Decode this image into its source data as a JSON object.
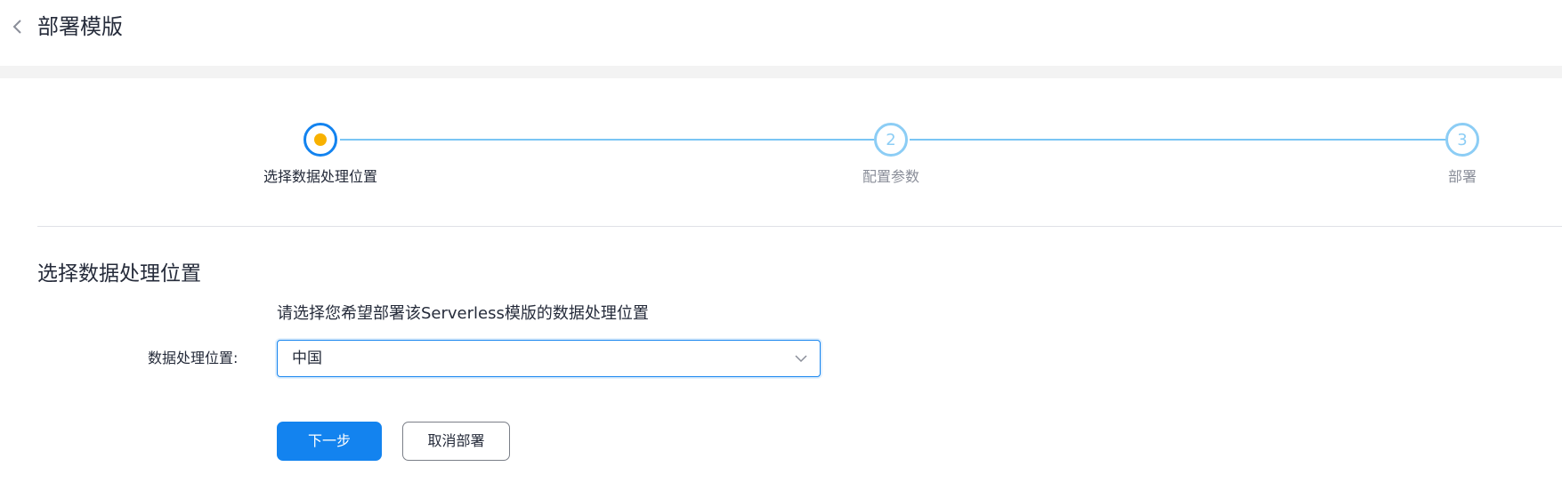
{
  "header": {
    "title": "部署模版"
  },
  "steps": [
    {
      "label": "选择数据处理位置",
      "number": "1",
      "state": "active"
    },
    {
      "label": "配置参数",
      "number": "2",
      "state": "pending"
    },
    {
      "label": "部署",
      "number": "3",
      "state": "pending"
    }
  ],
  "section": {
    "title": "选择数据处理位置",
    "hint": "请选择您希望部署该Serverless模版的数据处理位置"
  },
  "form": {
    "location_label": "数据处理位置:",
    "location_value": "中国"
  },
  "actions": {
    "next_label": "下一步",
    "cancel_label": "取消部署"
  },
  "colors": {
    "primary": "#1383ef",
    "active_dot": "#f8b100",
    "step_line": "#7ac5f4"
  },
  "icons": [
    "back-icon",
    "chevron-down-icon"
  ]
}
